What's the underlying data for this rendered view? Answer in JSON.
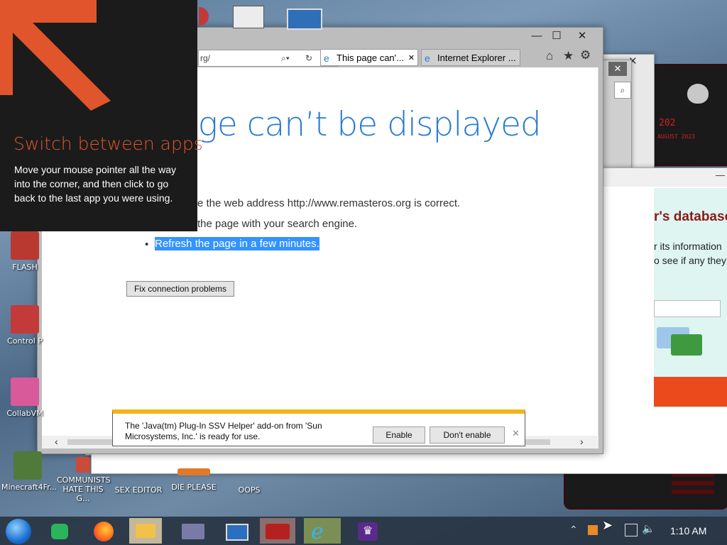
{
  "desktop_icons": [
    {
      "label": "FLASH",
      "color": "#b9382f"
    },
    {
      "label": "Control P",
      "color": "#c23a3a"
    },
    {
      "label": "CollabVM",
      "color": "#d85a9a"
    },
    {
      "label": "Minecraft4Fr...",
      "color": "#4f7a3a"
    },
    {
      "label": "COMMUNISTS HATE THIS G...",
      "color": "#c94b3a"
    },
    {
      "label": "SEX EDITOR",
      "color": "#2b3b55"
    },
    {
      "label": "DIE PLEASE",
      "color": "#e07a2a"
    },
    {
      "label": "OOPS",
      "color": "#3b4b60"
    }
  ],
  "charm_tip": {
    "title": "Switch between apps",
    "body": "Move your mouse pointer all the way into the corner, and then click to go back to the last app you were using."
  },
  "browser": {
    "address_fragment": "rg/",
    "tabs": [
      {
        "label": "This page can'...",
        "active": true
      },
      {
        "label": "Internet Explorer ...",
        "active": false
      }
    ],
    "page_title": "page can’t be displayed",
    "lines": [
      "e the web address http://www.remasteros.org is correct.",
      "the page with your search engine.",
      "Refresh the page in a few minutes."
    ],
    "fix_button": "Fix connection problems",
    "notification": {
      "text": "The 'Java(tm) Plug-In SSV Helper' add-on from 'Sun Microsystems, Inc.' is ready for use.",
      "enable": "Enable",
      "dont_enable": "Don't enable"
    }
  },
  "bg_window": {
    "heading": "r's database",
    "text1": "r its information",
    "text2": "o see if any they"
  },
  "alien_panel": {
    "num1": "202",
    "num2": "AUGUST 2023"
  },
  "taskbar": {
    "time": "1:10 AM"
  },
  "colors": {
    "accent_blue": "#2b7bd4",
    "tip_orange": "#e0552b",
    "notif_yellow": "#f3b31b"
  }
}
